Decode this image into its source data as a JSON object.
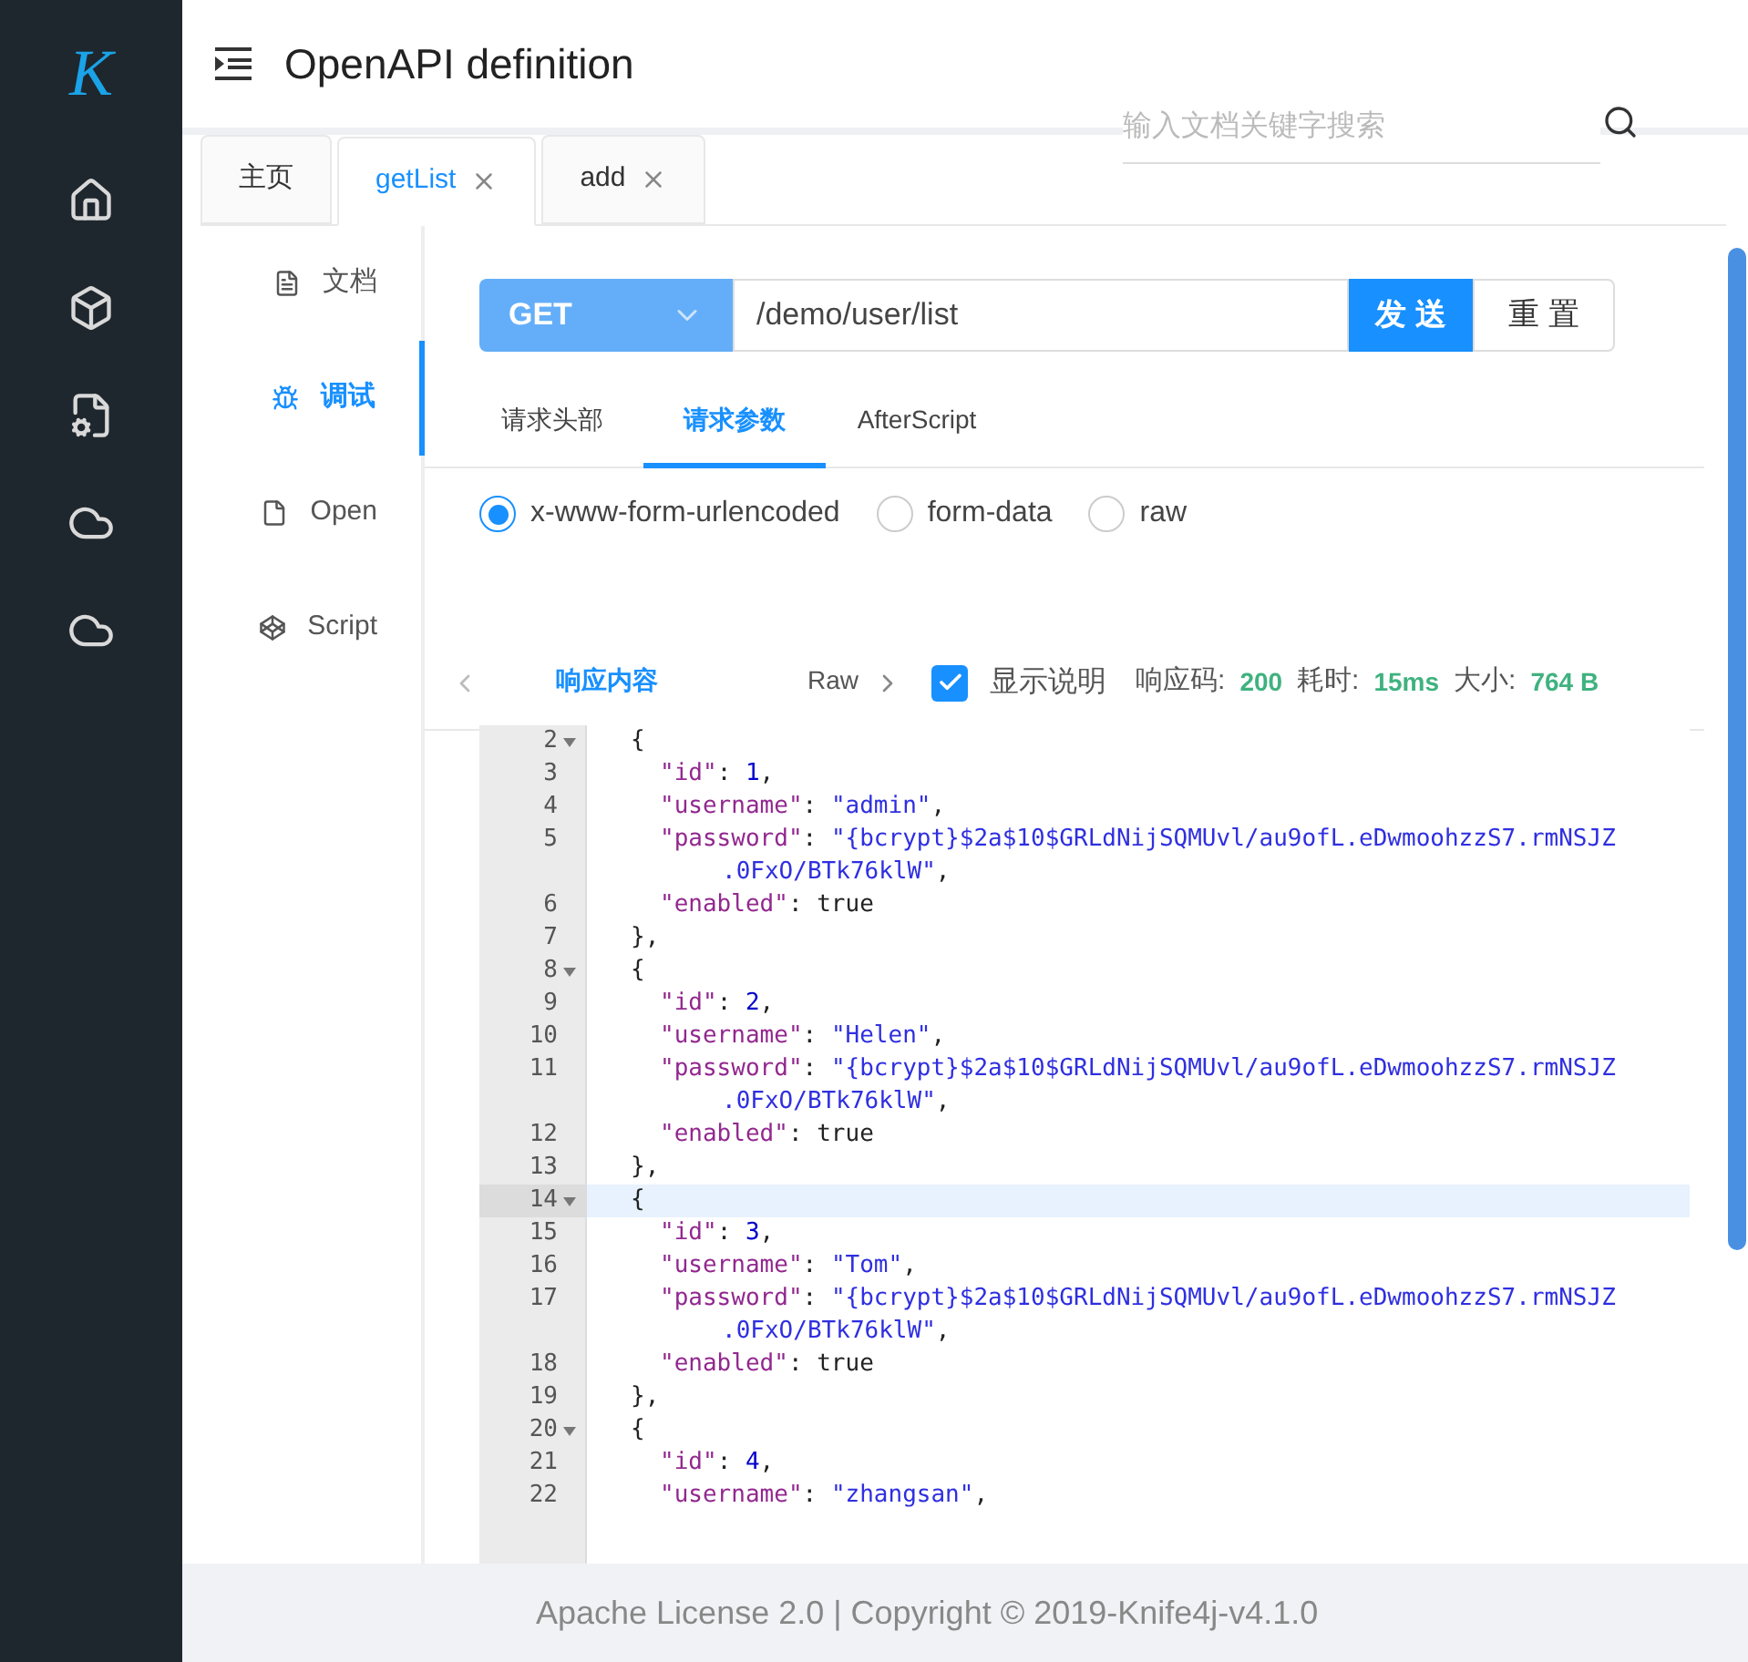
{
  "header": {
    "logo": "K",
    "title": "OpenAPI definition",
    "search": {
      "placeholder": "输入文档关键字搜索"
    }
  },
  "tabs": [
    {
      "label": "主页",
      "selected": false,
      "closable": false
    },
    {
      "label": "getList",
      "selected": true,
      "closable": true
    },
    {
      "label": "add",
      "selected": false,
      "closable": true
    }
  ],
  "doc_nav": [
    {
      "kind": "doc",
      "label": "文档",
      "selected": false
    },
    {
      "kind": "debug",
      "label": "调试",
      "selected": true
    },
    {
      "kind": "open",
      "label": "Open",
      "selected": false
    },
    {
      "kind": "script",
      "label": "Script",
      "selected": false
    }
  ],
  "request": {
    "method": "GET",
    "url": "/demo/user/list",
    "send": "发 送",
    "reset": "重 置",
    "tabs": [
      {
        "label": "请求头部",
        "selected": false
      },
      {
        "label": "请求参数",
        "selected": true
      },
      {
        "label": "AfterScript",
        "selected": false
      }
    ],
    "body_types": [
      {
        "label": "x-www-form-urlencoded",
        "selected": true
      },
      {
        "label": "form-data",
        "selected": false
      },
      {
        "label": "raw",
        "selected": false
      }
    ]
  },
  "response": {
    "tabs": [
      {
        "label": "响应内容",
        "selected": true
      },
      {
        "label": "Raw",
        "selected": false
      }
    ],
    "show_description": {
      "label": "显示说明",
      "checked": true
    },
    "stats": [
      {
        "label": "响应码:",
        "value": "200"
      },
      {
        "label": "耗时:",
        "value": "15ms"
      },
      {
        "label": "大小:",
        "value": "764 B"
      }
    ],
    "lines": [
      {
        "kind": "brace",
        "num": "2",
        "foldable": true,
        "active": false,
        "tokens": [
          {
            "kind": "plain",
            "text": "{"
          }
        ]
      },
      {
        "kind": "field",
        "num": "3",
        "foldable": false,
        "active": false,
        "tokens": [
          {
            "kind": "key",
            "text": "\"id\""
          },
          {
            "kind": "plain",
            "text": ": "
          },
          {
            "kind": "number",
            "text": "1"
          },
          {
            "kind": "plain",
            "text": ","
          }
        ]
      },
      {
        "kind": "field",
        "num": "4",
        "foldable": false,
        "active": false,
        "tokens": [
          {
            "kind": "key",
            "text": "\"username\""
          },
          {
            "kind": "plain",
            "text": ": "
          },
          {
            "kind": "string",
            "text": "\"admin\""
          },
          {
            "kind": "plain",
            "text": ","
          }
        ]
      },
      {
        "kind": "field",
        "num": "5",
        "foldable": false,
        "active": false,
        "tokens": [
          {
            "kind": "key",
            "text": "\"password\""
          },
          {
            "kind": "plain",
            "text": ": "
          },
          {
            "kind": "string",
            "text": "\"{bcrypt}$2a$10$GRLdNijSQMUvl/au9ofL.eDwmoohzzS7.rmNSJZ"
          }
        ]
      },
      {
        "kind": "wrap",
        "foldable": false,
        "active": false,
        "tokens": [
          {
            "kind": "string",
            "text": ".0FxO/BTk76klW\""
          },
          {
            "kind": "plain",
            "text": ","
          }
        ]
      },
      {
        "kind": "field",
        "num": "6",
        "foldable": false,
        "active": false,
        "tokens": [
          {
            "kind": "key",
            "text": "\"enabled\""
          },
          {
            "kind": "plain",
            "text": ": true"
          }
        ]
      },
      {
        "kind": "brace",
        "num": "7",
        "foldable": false,
        "active": false,
        "tokens": [
          {
            "kind": "plain",
            "text": "},"
          }
        ]
      },
      {
        "kind": "brace",
        "num": "8",
        "foldable": true,
        "active": false,
        "tokens": [
          {
            "kind": "plain",
            "text": "{"
          }
        ]
      },
      {
        "kind": "field",
        "num": "9",
        "foldable": false,
        "active": false,
        "tokens": [
          {
            "kind": "key",
            "text": "\"id\""
          },
          {
            "kind": "plain",
            "text": ": "
          },
          {
            "kind": "number",
            "text": "2"
          },
          {
            "kind": "plain",
            "text": ","
          }
        ]
      },
      {
        "kind": "field",
        "num": "10",
        "foldable": false,
        "active": false,
        "tokens": [
          {
            "kind": "key",
            "text": "\"username\""
          },
          {
            "kind": "plain",
            "text": ": "
          },
          {
            "kind": "string",
            "text": "\"Helen\""
          },
          {
            "kind": "plain",
            "text": ","
          }
        ]
      },
      {
        "kind": "field",
        "num": "11",
        "foldable": false,
        "active": false,
        "tokens": [
          {
            "kind": "key",
            "text": "\"password\""
          },
          {
            "kind": "plain",
            "text": ": "
          },
          {
            "kind": "string",
            "text": "\"{bcrypt}$2a$10$GRLdNijSQMUvl/au9ofL.eDwmoohzzS7.rmNSJZ"
          }
        ]
      },
      {
        "kind": "wrap",
        "foldable": false,
        "active": false,
        "tokens": [
          {
            "kind": "string",
            "text": ".0FxO/BTk76klW\""
          },
          {
            "kind": "plain",
            "text": ","
          }
        ]
      },
      {
        "kind": "field",
        "num": "12",
        "foldable": false,
        "active": false,
        "tokens": [
          {
            "kind": "key",
            "text": "\"enabled\""
          },
          {
            "kind": "plain",
            "text": ": true"
          }
        ]
      },
      {
        "kind": "brace",
        "num": "13",
        "foldable": false,
        "active": false,
        "tokens": [
          {
            "kind": "plain",
            "text": "},"
          }
        ]
      },
      {
        "kind": "brace",
        "num": "14",
        "foldable": true,
        "active": true,
        "tokens": [
          {
            "kind": "plain",
            "text": "{"
          }
        ]
      },
      {
        "kind": "field",
        "num": "15",
        "foldable": false,
        "active": false,
        "tokens": [
          {
            "kind": "key",
            "text": "\"id\""
          },
          {
            "kind": "plain",
            "text": ": "
          },
          {
            "kind": "number",
            "text": "3"
          },
          {
            "kind": "plain",
            "text": ","
          }
        ]
      },
      {
        "kind": "field",
        "num": "16",
        "foldable": false,
        "active": false,
        "tokens": [
          {
            "kind": "key",
            "text": "\"username\""
          },
          {
            "kind": "plain",
            "text": ": "
          },
          {
            "kind": "string",
            "text": "\"Tom\""
          },
          {
            "kind": "plain",
            "text": ","
          }
        ]
      },
      {
        "kind": "field",
        "num": "17",
        "foldable": false,
        "active": false,
        "tokens": [
          {
            "kind": "key",
            "text": "\"password\""
          },
          {
            "kind": "plain",
            "text": ": "
          },
          {
            "kind": "string",
            "text": "\"{bcrypt}$2a$10$GRLdNijSQMUvl/au9ofL.eDwmoohzzS7.rmNSJZ"
          }
        ]
      },
      {
        "kind": "wrap",
        "foldable": false,
        "active": false,
        "tokens": [
          {
            "kind": "string",
            "text": ".0FxO/BTk76klW\""
          },
          {
            "kind": "plain",
            "text": ","
          }
        ]
      },
      {
        "kind": "field",
        "num": "18",
        "foldable": false,
        "active": false,
        "tokens": [
          {
            "kind": "key",
            "text": "\"enabled\""
          },
          {
            "kind": "plain",
            "text": ": true"
          }
        ]
      },
      {
        "kind": "brace",
        "num": "19",
        "foldable": false,
        "active": false,
        "tokens": [
          {
            "kind": "plain",
            "text": "},"
          }
        ]
      },
      {
        "kind": "brace",
        "num": "20",
        "foldable": true,
        "active": false,
        "tokens": [
          {
            "kind": "plain",
            "text": "{"
          }
        ]
      },
      {
        "kind": "field",
        "num": "21",
        "foldable": false,
        "active": false,
        "tokens": [
          {
            "kind": "key",
            "text": "\"id\""
          },
          {
            "kind": "plain",
            "text": ": "
          },
          {
            "kind": "number",
            "text": "4"
          },
          {
            "kind": "plain",
            "text": ","
          }
        ]
      },
      {
        "kind": "field",
        "num": "22",
        "foldable": false,
        "active": false,
        "tokens": [
          {
            "kind": "key",
            "text": "\"username\""
          },
          {
            "kind": "plain",
            "text": ": "
          },
          {
            "kind": "string",
            "text": "\"zhangsan\""
          },
          {
            "kind": "plain",
            "text": ","
          }
        ]
      }
    ]
  },
  "footer": "Apache License 2.0 | Copyright © 2019-Knife4j-v4.1.0"
}
